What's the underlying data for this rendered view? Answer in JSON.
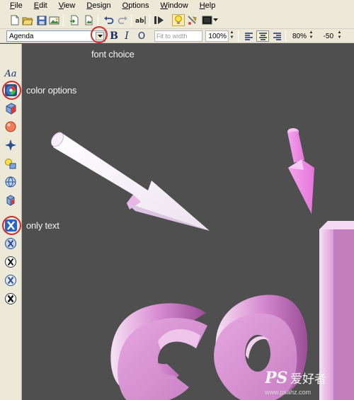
{
  "menu": [
    "File",
    "Edit",
    "View",
    "Design",
    "Options",
    "Window",
    "Help"
  ],
  "toolbar2": {
    "font_name": "Agenda",
    "bold_label": "B",
    "italic_label": "I",
    "outline_label": "O",
    "fit_placeholder": "Fit to width",
    "zoom_value": "100%",
    "scale_value": "80%",
    "rotation_value": "-50"
  },
  "palette": {
    "text_tool_label": "Aa"
  },
  "annotations": {
    "font_choice": "font choice",
    "color_options": "color options",
    "only_text": "only text"
  },
  "watermark": {
    "logo_text": "PS爱好者",
    "url": "www.psahz.com"
  },
  "colors": {
    "canvas": "#4f4f4f",
    "chrome": "#ece9d8",
    "highlight_circle": "#d62828",
    "text_3d": "#d98fd3",
    "arrow_white": "#f6f2f7",
    "arrow_pink": "#f08ae6"
  }
}
